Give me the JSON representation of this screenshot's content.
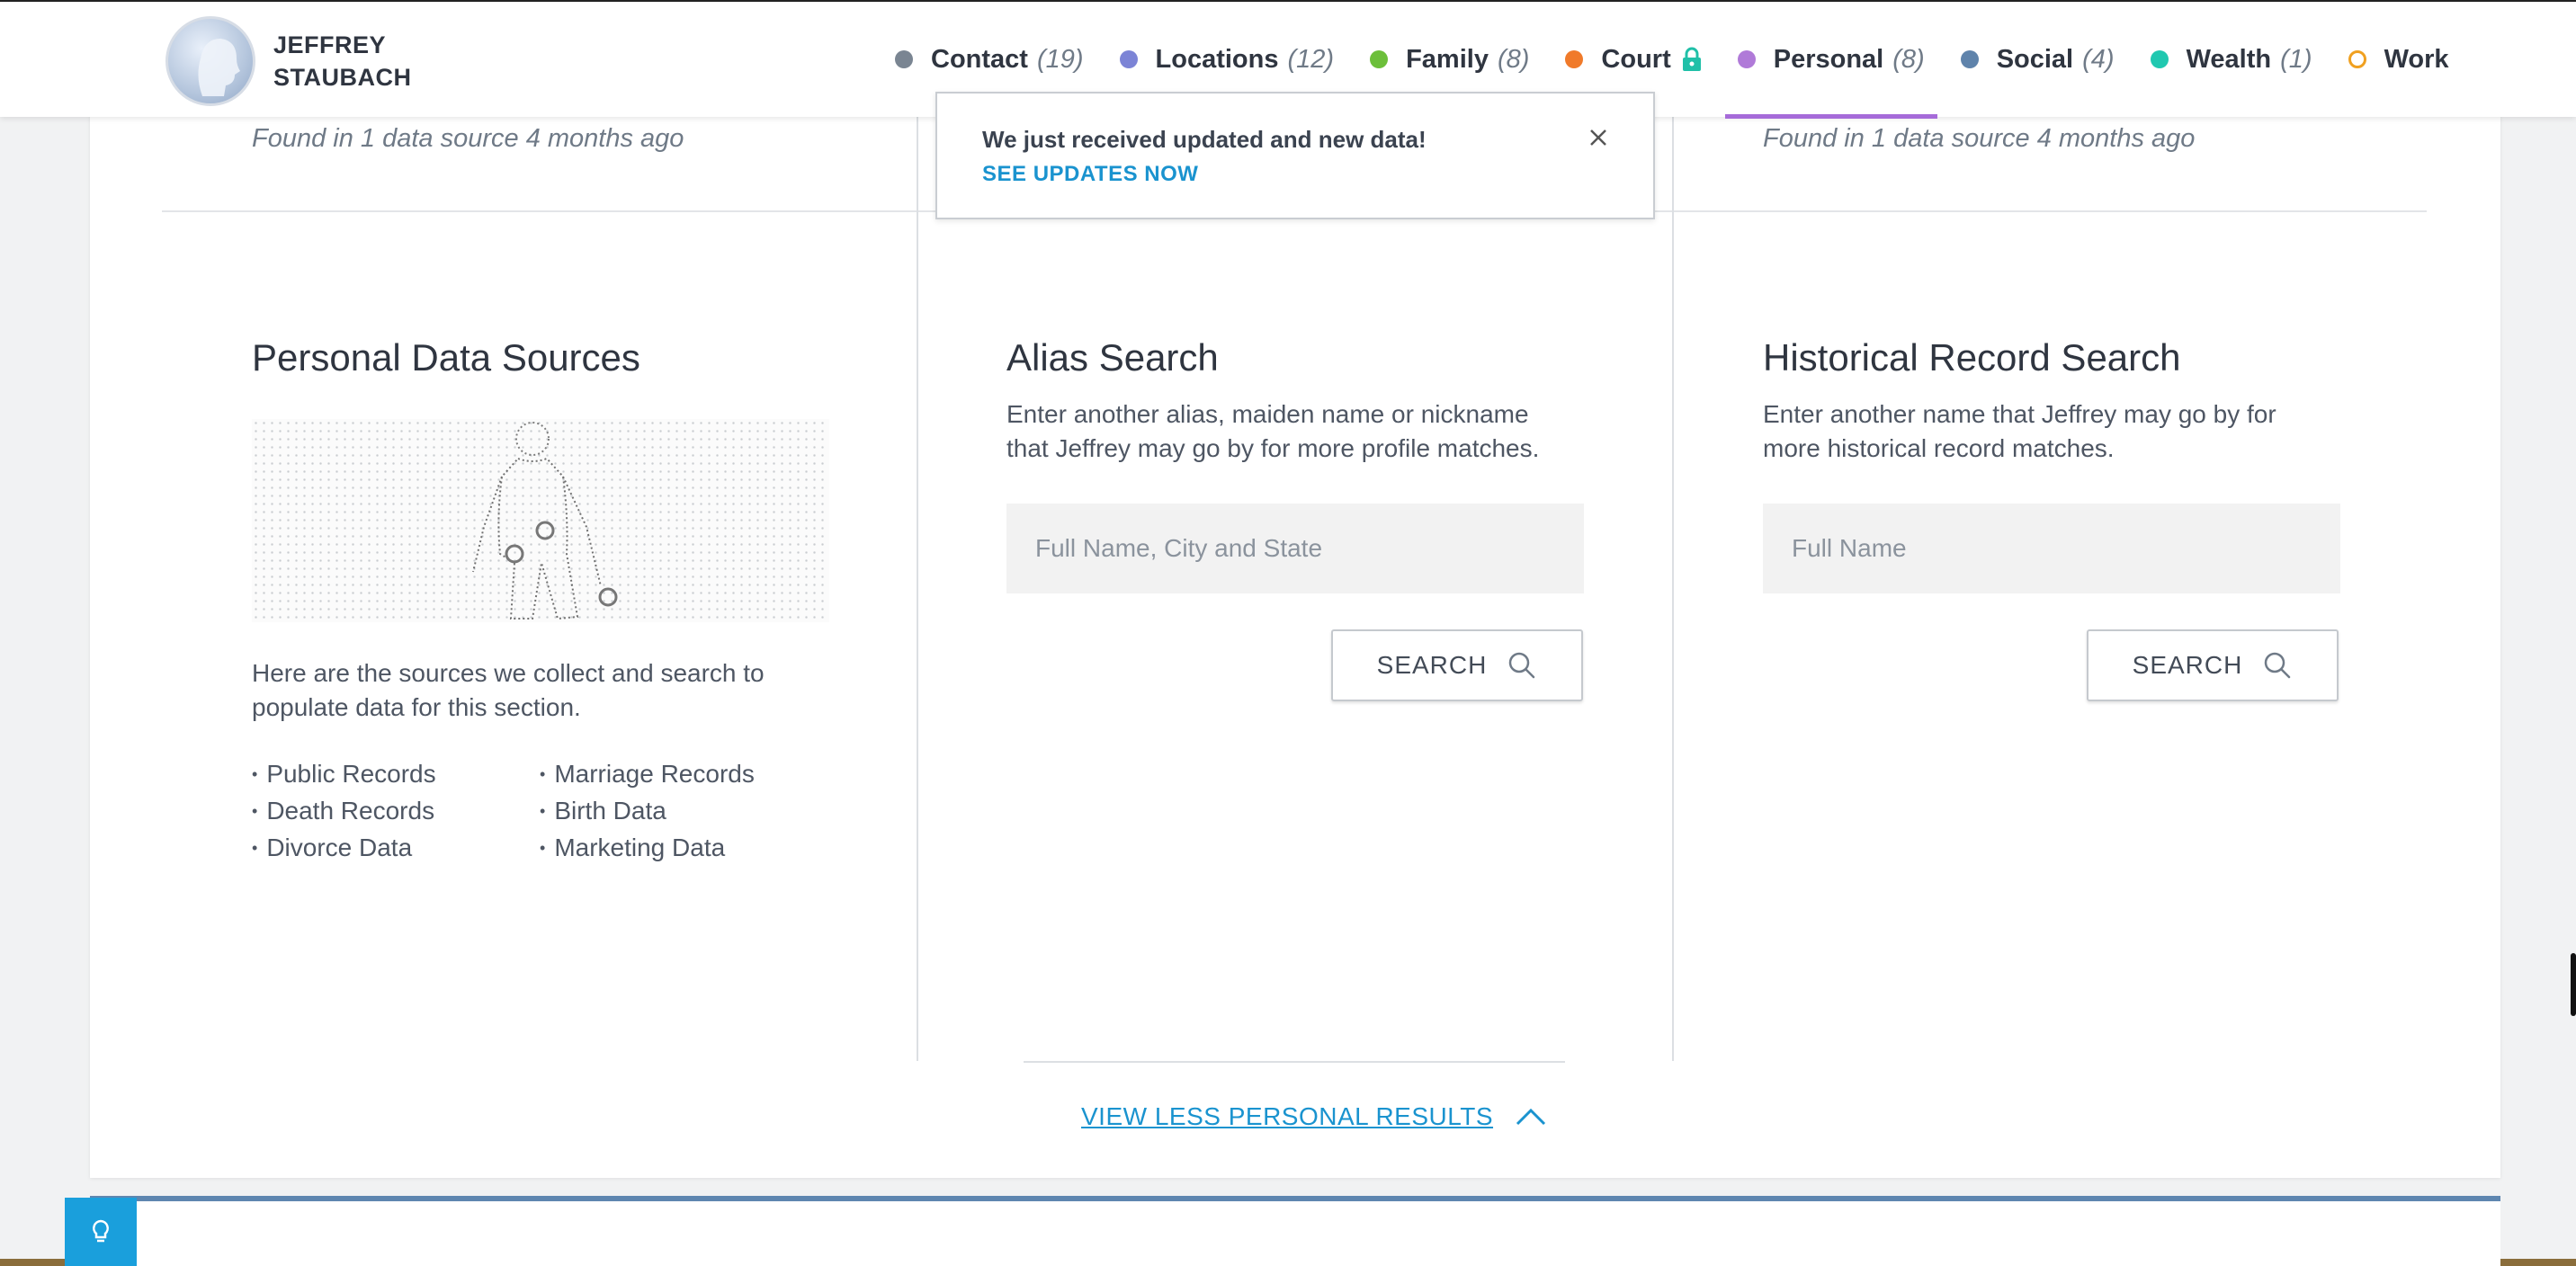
{
  "header": {
    "name_line1": "JEFFREY",
    "name_line2": "STAUBACH",
    "nav": [
      {
        "label": "Contact",
        "count": "(19)",
        "color": "#7a8592"
      },
      {
        "label": "Locations",
        "count": "(12)",
        "color": "#7c84d6"
      },
      {
        "label": "Family",
        "count": "(8)",
        "color": "#6cbf3a"
      },
      {
        "label": "Court",
        "count": "",
        "color": "#f07a2a",
        "locked": true
      },
      {
        "label": "Personal",
        "count": "(8)",
        "color": "#b07ad8",
        "active": true
      },
      {
        "label": "Social",
        "count": "(4)",
        "color": "#5f83ab"
      },
      {
        "label": "Wealth",
        "count": "(1)",
        "color": "#20c8b0"
      },
      {
        "label": "Work",
        "count": "",
        "color": "#f0a020",
        "hollow": true
      }
    ]
  },
  "toast": {
    "message": "We just received updated and new data!",
    "link": "SEE UPDATES NOW"
  },
  "found_left": "Found in 1 data source 4 months ago",
  "found_right": "Found in 1 data source 4 months ago",
  "sources": {
    "title": "Personal Data Sources",
    "description_line1": "Here are the sources we collect and search to",
    "description_line2": "populate data for this section.",
    "list_left": [
      "Public Records",
      "Death Records",
      "Divorce Data"
    ],
    "list_right": [
      "Marriage Records",
      "Birth Data",
      "Marketing Data"
    ]
  },
  "alias": {
    "title": "Alias Search",
    "description_line1": "Enter another alias, maiden name or nickname",
    "description_line2": "that Jeffrey may go by for more profile matches.",
    "placeholder": "Full Name, City and State",
    "button": "SEARCH"
  },
  "historical": {
    "title": "Historical Record Search",
    "description_line1": "Enter another name that Jeffrey may go by for",
    "description_line2": "more historical record matches.",
    "placeholder": "Full Name",
    "button": "SEARCH"
  },
  "view_less": "VIEW LESS PERSONAL RESULTS",
  "colors": {
    "link": "#1a93cf",
    "active_tab": "#a66bd9",
    "help_button": "#1a9fdc"
  }
}
